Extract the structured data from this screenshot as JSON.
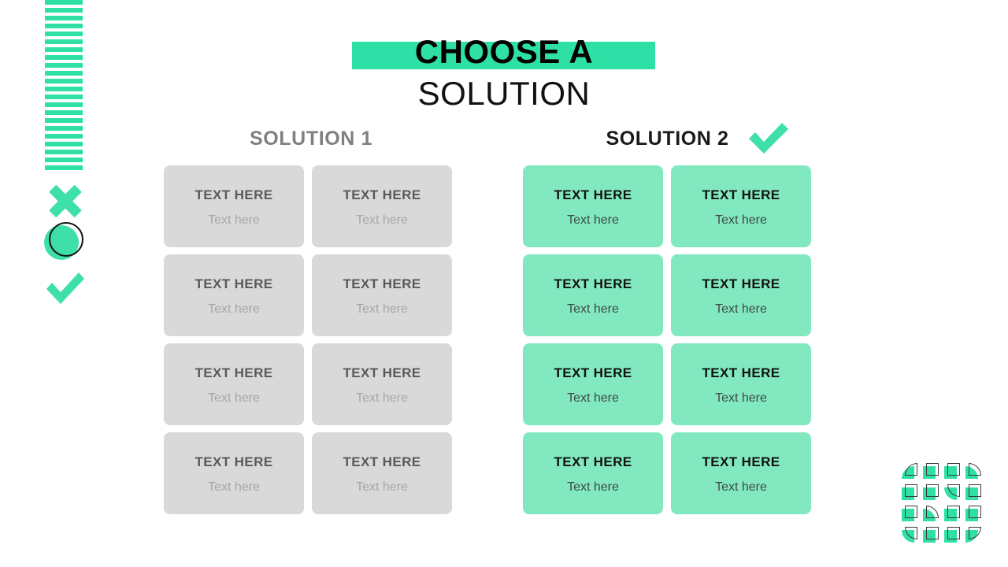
{
  "title": {
    "line1": "CHOOSE A",
    "line2": "SOLUTION",
    "highlight_color": "#2ee0a5"
  },
  "columns": [
    {
      "heading": "SOLUTION 1",
      "heading_color": "#808080",
      "card_color": "#d9d9d9",
      "selected": false,
      "cards": [
        {
          "title": "TEXT HERE",
          "subtitle": "Text here"
        },
        {
          "title": "TEXT HERE",
          "subtitle": "Text here"
        },
        {
          "title": "TEXT HERE",
          "subtitle": "Text here"
        },
        {
          "title": "TEXT HERE",
          "subtitle": "Text here"
        },
        {
          "title": "TEXT HERE",
          "subtitle": "Text here"
        },
        {
          "title": "TEXT HERE",
          "subtitle": "Text here"
        },
        {
          "title": "TEXT HERE",
          "subtitle": "Text here"
        },
        {
          "title": "TEXT HERE",
          "subtitle": "Text here"
        }
      ]
    },
    {
      "heading": "SOLUTION 2",
      "heading_color": "#1a1a1a",
      "card_color": "#81e8c0",
      "selected": true,
      "cards": [
        {
          "title": "TEXT HERE",
          "subtitle": "Text here"
        },
        {
          "title": "TEXT HERE",
          "subtitle": "Text here"
        },
        {
          "title": "TEXT HERE",
          "subtitle": "Text here"
        },
        {
          "title": "TEXT HERE",
          "subtitle": "Text here"
        },
        {
          "title": "TEXT HERE",
          "subtitle": "Text here"
        },
        {
          "title": "TEXT HERE",
          "subtitle": "Text here"
        },
        {
          "title": "TEXT HERE",
          "subtitle": "Text here"
        },
        {
          "title": "TEXT HERE",
          "subtitle": "Text here"
        }
      ]
    }
  ],
  "decorations": {
    "stripes": {
      "icon": "horizontal-stripes",
      "color": "#2ee0a5",
      "count": 22
    },
    "icons": [
      {
        "icon": "cross-icon",
        "color": "#3ee0a8"
      },
      {
        "icon": "circle-icon",
        "color": "#3ee0a8"
      },
      {
        "icon": "check-icon",
        "color": "#3ee0a8"
      }
    ],
    "selected_marker": {
      "icon": "check-icon",
      "color": "#3ee0a8"
    },
    "corner_pattern": {
      "icon": "square-dot-grid",
      "fill_color": "#2ee0a5",
      "outline_color": "#3a3a3a",
      "rows": 4,
      "columns": 4
    }
  }
}
